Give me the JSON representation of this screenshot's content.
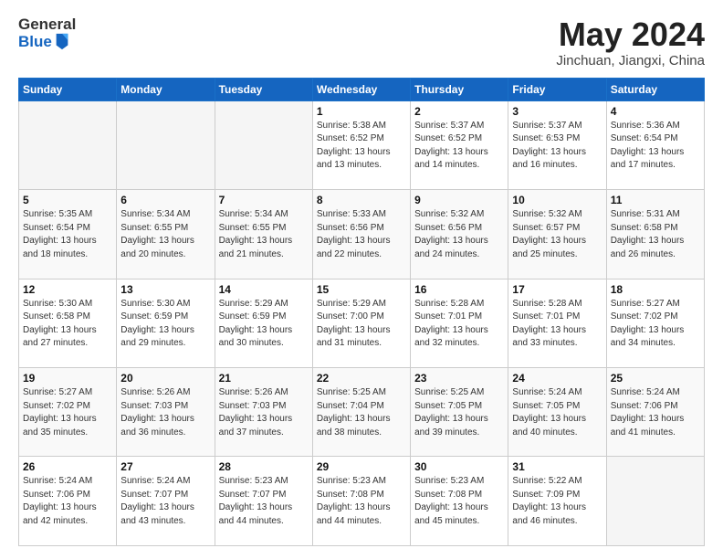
{
  "header": {
    "logo_general": "General",
    "logo_blue": "Blue",
    "month_year": "May 2024",
    "location": "Jinchuan, Jiangxi, China"
  },
  "days_of_week": [
    "Sunday",
    "Monday",
    "Tuesday",
    "Wednesday",
    "Thursday",
    "Friday",
    "Saturday"
  ],
  "weeks": [
    [
      {
        "day": "",
        "info": ""
      },
      {
        "day": "",
        "info": ""
      },
      {
        "day": "",
        "info": ""
      },
      {
        "day": "1",
        "info": "Sunrise: 5:38 AM\nSunset: 6:52 PM\nDaylight: 13 hours\nand 13 minutes."
      },
      {
        "day": "2",
        "info": "Sunrise: 5:37 AM\nSunset: 6:52 PM\nDaylight: 13 hours\nand 14 minutes."
      },
      {
        "day": "3",
        "info": "Sunrise: 5:37 AM\nSunset: 6:53 PM\nDaylight: 13 hours\nand 16 minutes."
      },
      {
        "day": "4",
        "info": "Sunrise: 5:36 AM\nSunset: 6:54 PM\nDaylight: 13 hours\nand 17 minutes."
      }
    ],
    [
      {
        "day": "5",
        "info": "Sunrise: 5:35 AM\nSunset: 6:54 PM\nDaylight: 13 hours\nand 18 minutes."
      },
      {
        "day": "6",
        "info": "Sunrise: 5:34 AM\nSunset: 6:55 PM\nDaylight: 13 hours\nand 20 minutes."
      },
      {
        "day": "7",
        "info": "Sunrise: 5:34 AM\nSunset: 6:55 PM\nDaylight: 13 hours\nand 21 minutes."
      },
      {
        "day": "8",
        "info": "Sunrise: 5:33 AM\nSunset: 6:56 PM\nDaylight: 13 hours\nand 22 minutes."
      },
      {
        "day": "9",
        "info": "Sunrise: 5:32 AM\nSunset: 6:56 PM\nDaylight: 13 hours\nand 24 minutes."
      },
      {
        "day": "10",
        "info": "Sunrise: 5:32 AM\nSunset: 6:57 PM\nDaylight: 13 hours\nand 25 minutes."
      },
      {
        "day": "11",
        "info": "Sunrise: 5:31 AM\nSunset: 6:58 PM\nDaylight: 13 hours\nand 26 minutes."
      }
    ],
    [
      {
        "day": "12",
        "info": "Sunrise: 5:30 AM\nSunset: 6:58 PM\nDaylight: 13 hours\nand 27 minutes."
      },
      {
        "day": "13",
        "info": "Sunrise: 5:30 AM\nSunset: 6:59 PM\nDaylight: 13 hours\nand 29 minutes."
      },
      {
        "day": "14",
        "info": "Sunrise: 5:29 AM\nSunset: 6:59 PM\nDaylight: 13 hours\nand 30 minutes."
      },
      {
        "day": "15",
        "info": "Sunrise: 5:29 AM\nSunset: 7:00 PM\nDaylight: 13 hours\nand 31 minutes."
      },
      {
        "day": "16",
        "info": "Sunrise: 5:28 AM\nSunset: 7:01 PM\nDaylight: 13 hours\nand 32 minutes."
      },
      {
        "day": "17",
        "info": "Sunrise: 5:28 AM\nSunset: 7:01 PM\nDaylight: 13 hours\nand 33 minutes."
      },
      {
        "day": "18",
        "info": "Sunrise: 5:27 AM\nSunset: 7:02 PM\nDaylight: 13 hours\nand 34 minutes."
      }
    ],
    [
      {
        "day": "19",
        "info": "Sunrise: 5:27 AM\nSunset: 7:02 PM\nDaylight: 13 hours\nand 35 minutes."
      },
      {
        "day": "20",
        "info": "Sunrise: 5:26 AM\nSunset: 7:03 PM\nDaylight: 13 hours\nand 36 minutes."
      },
      {
        "day": "21",
        "info": "Sunrise: 5:26 AM\nSunset: 7:03 PM\nDaylight: 13 hours\nand 37 minutes."
      },
      {
        "day": "22",
        "info": "Sunrise: 5:25 AM\nSunset: 7:04 PM\nDaylight: 13 hours\nand 38 minutes."
      },
      {
        "day": "23",
        "info": "Sunrise: 5:25 AM\nSunset: 7:05 PM\nDaylight: 13 hours\nand 39 minutes."
      },
      {
        "day": "24",
        "info": "Sunrise: 5:24 AM\nSunset: 7:05 PM\nDaylight: 13 hours\nand 40 minutes."
      },
      {
        "day": "25",
        "info": "Sunrise: 5:24 AM\nSunset: 7:06 PM\nDaylight: 13 hours\nand 41 minutes."
      }
    ],
    [
      {
        "day": "26",
        "info": "Sunrise: 5:24 AM\nSunset: 7:06 PM\nDaylight: 13 hours\nand 42 minutes."
      },
      {
        "day": "27",
        "info": "Sunrise: 5:24 AM\nSunset: 7:07 PM\nDaylight: 13 hours\nand 43 minutes."
      },
      {
        "day": "28",
        "info": "Sunrise: 5:23 AM\nSunset: 7:07 PM\nDaylight: 13 hours\nand 44 minutes."
      },
      {
        "day": "29",
        "info": "Sunrise: 5:23 AM\nSunset: 7:08 PM\nDaylight: 13 hours\nand 44 minutes."
      },
      {
        "day": "30",
        "info": "Sunrise: 5:23 AM\nSunset: 7:08 PM\nDaylight: 13 hours\nand 45 minutes."
      },
      {
        "day": "31",
        "info": "Sunrise: 5:22 AM\nSunset: 7:09 PM\nDaylight: 13 hours\nand 46 minutes."
      },
      {
        "day": "",
        "info": ""
      }
    ]
  ]
}
